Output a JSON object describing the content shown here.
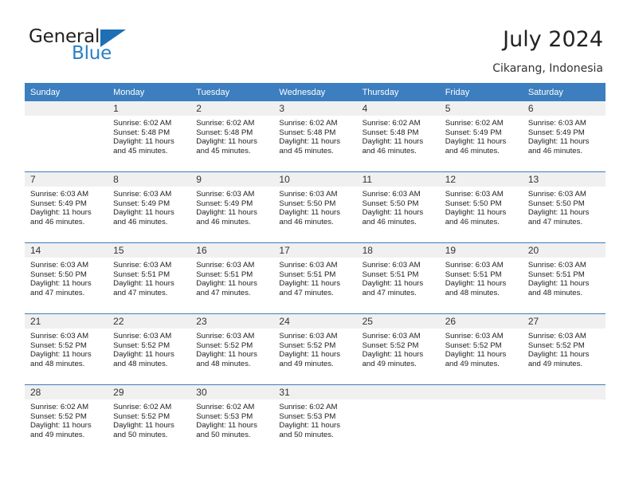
{
  "brand": {
    "name_top": "General",
    "name_bottom": "Blue",
    "triangle_color": "#1f6fb5",
    "blue_color": "#2980c4"
  },
  "header": {
    "title": "July 2024",
    "location": "Cikarang, Indonesia"
  },
  "theme": {
    "header_bg": "#3c7ebf",
    "header_text": "#ffffff",
    "daynum_band": "#f0f0f0",
    "divider": "#3c7ebf"
  },
  "weekdays": [
    "Sunday",
    "Monday",
    "Tuesday",
    "Wednesday",
    "Thursday",
    "Friday",
    "Saturday"
  ],
  "weeks": [
    [
      {
        "day": "",
        "sunrise": "",
        "sunset": "",
        "daylight_line1": "",
        "daylight_line2": ""
      },
      {
        "day": "1",
        "sunrise": "Sunrise: 6:02 AM",
        "sunset": "Sunset: 5:48 PM",
        "daylight_line1": "Daylight: 11 hours",
        "daylight_line2": "and 45 minutes."
      },
      {
        "day": "2",
        "sunrise": "Sunrise: 6:02 AM",
        "sunset": "Sunset: 5:48 PM",
        "daylight_line1": "Daylight: 11 hours",
        "daylight_line2": "and 45 minutes."
      },
      {
        "day": "3",
        "sunrise": "Sunrise: 6:02 AM",
        "sunset": "Sunset: 5:48 PM",
        "daylight_line1": "Daylight: 11 hours",
        "daylight_line2": "and 45 minutes."
      },
      {
        "day": "4",
        "sunrise": "Sunrise: 6:02 AM",
        "sunset": "Sunset: 5:48 PM",
        "daylight_line1": "Daylight: 11 hours",
        "daylight_line2": "and 46 minutes."
      },
      {
        "day": "5",
        "sunrise": "Sunrise: 6:02 AM",
        "sunset": "Sunset: 5:49 PM",
        "daylight_line1": "Daylight: 11 hours",
        "daylight_line2": "and 46 minutes."
      },
      {
        "day": "6",
        "sunrise": "Sunrise: 6:03 AM",
        "sunset": "Sunset: 5:49 PM",
        "daylight_line1": "Daylight: 11 hours",
        "daylight_line2": "and 46 minutes."
      }
    ],
    [
      {
        "day": "7",
        "sunrise": "Sunrise: 6:03 AM",
        "sunset": "Sunset: 5:49 PM",
        "daylight_line1": "Daylight: 11 hours",
        "daylight_line2": "and 46 minutes."
      },
      {
        "day": "8",
        "sunrise": "Sunrise: 6:03 AM",
        "sunset": "Sunset: 5:49 PM",
        "daylight_line1": "Daylight: 11 hours",
        "daylight_line2": "and 46 minutes."
      },
      {
        "day": "9",
        "sunrise": "Sunrise: 6:03 AM",
        "sunset": "Sunset: 5:49 PM",
        "daylight_line1": "Daylight: 11 hours",
        "daylight_line2": "and 46 minutes."
      },
      {
        "day": "10",
        "sunrise": "Sunrise: 6:03 AM",
        "sunset": "Sunset: 5:50 PM",
        "daylight_line1": "Daylight: 11 hours",
        "daylight_line2": "and 46 minutes."
      },
      {
        "day": "11",
        "sunrise": "Sunrise: 6:03 AM",
        "sunset": "Sunset: 5:50 PM",
        "daylight_line1": "Daylight: 11 hours",
        "daylight_line2": "and 46 minutes."
      },
      {
        "day": "12",
        "sunrise": "Sunrise: 6:03 AM",
        "sunset": "Sunset: 5:50 PM",
        "daylight_line1": "Daylight: 11 hours",
        "daylight_line2": "and 46 minutes."
      },
      {
        "day": "13",
        "sunrise": "Sunrise: 6:03 AM",
        "sunset": "Sunset: 5:50 PM",
        "daylight_line1": "Daylight: 11 hours",
        "daylight_line2": "and 47 minutes."
      }
    ],
    [
      {
        "day": "14",
        "sunrise": "Sunrise: 6:03 AM",
        "sunset": "Sunset: 5:50 PM",
        "daylight_line1": "Daylight: 11 hours",
        "daylight_line2": "and 47 minutes."
      },
      {
        "day": "15",
        "sunrise": "Sunrise: 6:03 AM",
        "sunset": "Sunset: 5:51 PM",
        "daylight_line1": "Daylight: 11 hours",
        "daylight_line2": "and 47 minutes."
      },
      {
        "day": "16",
        "sunrise": "Sunrise: 6:03 AM",
        "sunset": "Sunset: 5:51 PM",
        "daylight_line1": "Daylight: 11 hours",
        "daylight_line2": "and 47 minutes."
      },
      {
        "day": "17",
        "sunrise": "Sunrise: 6:03 AM",
        "sunset": "Sunset: 5:51 PM",
        "daylight_line1": "Daylight: 11 hours",
        "daylight_line2": "and 47 minutes."
      },
      {
        "day": "18",
        "sunrise": "Sunrise: 6:03 AM",
        "sunset": "Sunset: 5:51 PM",
        "daylight_line1": "Daylight: 11 hours",
        "daylight_line2": "and 47 minutes."
      },
      {
        "day": "19",
        "sunrise": "Sunrise: 6:03 AM",
        "sunset": "Sunset: 5:51 PM",
        "daylight_line1": "Daylight: 11 hours",
        "daylight_line2": "and 48 minutes."
      },
      {
        "day": "20",
        "sunrise": "Sunrise: 6:03 AM",
        "sunset": "Sunset: 5:51 PM",
        "daylight_line1": "Daylight: 11 hours",
        "daylight_line2": "and 48 minutes."
      }
    ],
    [
      {
        "day": "21",
        "sunrise": "Sunrise: 6:03 AM",
        "sunset": "Sunset: 5:52 PM",
        "daylight_line1": "Daylight: 11 hours",
        "daylight_line2": "and 48 minutes."
      },
      {
        "day": "22",
        "sunrise": "Sunrise: 6:03 AM",
        "sunset": "Sunset: 5:52 PM",
        "daylight_line1": "Daylight: 11 hours",
        "daylight_line2": "and 48 minutes."
      },
      {
        "day": "23",
        "sunrise": "Sunrise: 6:03 AM",
        "sunset": "Sunset: 5:52 PM",
        "daylight_line1": "Daylight: 11 hours",
        "daylight_line2": "and 48 minutes."
      },
      {
        "day": "24",
        "sunrise": "Sunrise: 6:03 AM",
        "sunset": "Sunset: 5:52 PM",
        "daylight_line1": "Daylight: 11 hours",
        "daylight_line2": "and 49 minutes."
      },
      {
        "day": "25",
        "sunrise": "Sunrise: 6:03 AM",
        "sunset": "Sunset: 5:52 PM",
        "daylight_line1": "Daylight: 11 hours",
        "daylight_line2": "and 49 minutes."
      },
      {
        "day": "26",
        "sunrise": "Sunrise: 6:03 AM",
        "sunset": "Sunset: 5:52 PM",
        "daylight_line1": "Daylight: 11 hours",
        "daylight_line2": "and 49 minutes."
      },
      {
        "day": "27",
        "sunrise": "Sunrise: 6:03 AM",
        "sunset": "Sunset: 5:52 PM",
        "daylight_line1": "Daylight: 11 hours",
        "daylight_line2": "and 49 minutes."
      }
    ],
    [
      {
        "day": "28",
        "sunrise": "Sunrise: 6:02 AM",
        "sunset": "Sunset: 5:52 PM",
        "daylight_line1": "Daylight: 11 hours",
        "daylight_line2": "and 49 minutes."
      },
      {
        "day": "29",
        "sunrise": "Sunrise: 6:02 AM",
        "sunset": "Sunset: 5:52 PM",
        "daylight_line1": "Daylight: 11 hours",
        "daylight_line2": "and 50 minutes."
      },
      {
        "day": "30",
        "sunrise": "Sunrise: 6:02 AM",
        "sunset": "Sunset: 5:53 PM",
        "daylight_line1": "Daylight: 11 hours",
        "daylight_line2": "and 50 minutes."
      },
      {
        "day": "31",
        "sunrise": "Sunrise: 6:02 AM",
        "sunset": "Sunset: 5:53 PM",
        "daylight_line1": "Daylight: 11 hours",
        "daylight_line2": "and 50 minutes."
      },
      {
        "day": "",
        "sunrise": "",
        "sunset": "",
        "daylight_line1": "",
        "daylight_line2": ""
      },
      {
        "day": "",
        "sunrise": "",
        "sunset": "",
        "daylight_line1": "",
        "daylight_line2": ""
      },
      {
        "day": "",
        "sunrise": "",
        "sunset": "",
        "daylight_line1": "",
        "daylight_line2": ""
      }
    ]
  ]
}
